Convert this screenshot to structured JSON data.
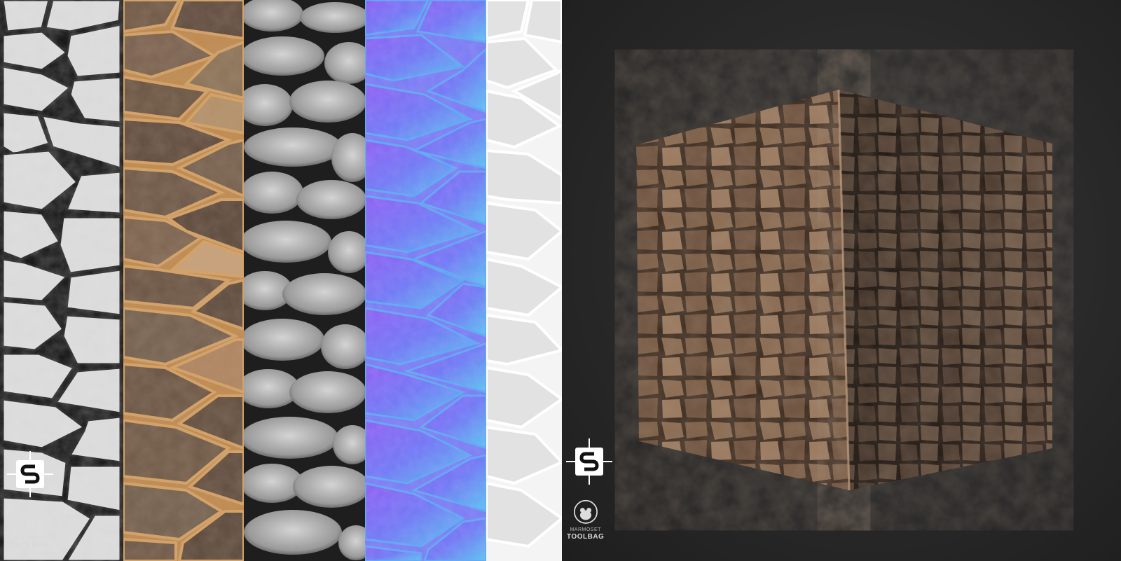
{
  "maps": [
    {
      "name": "height-map-strip"
    },
    {
      "name": "albedo-map-strip"
    },
    {
      "name": "ambient-occlusion-map-strip"
    },
    {
      "name": "normal-map-strip"
    },
    {
      "name": "roughness-map-strip"
    }
  ],
  "logos": {
    "substance_icon": "substance-logo-icon",
    "marmoset_top": "MARMOSET",
    "marmoset_bottom": "TOOLBAG"
  },
  "colors": {
    "preview_bg": "#2b2b2b",
    "stone_brown": "#7a5c44",
    "normal_blue": "#6f6ef2"
  }
}
